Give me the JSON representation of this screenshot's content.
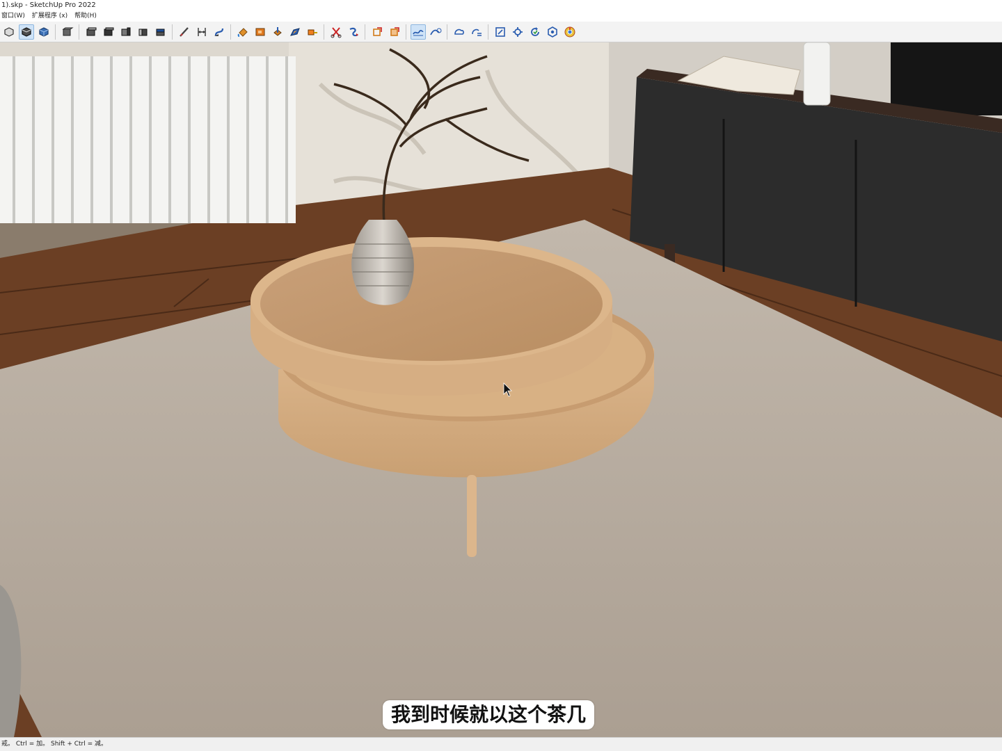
{
  "window": {
    "title": "1).skp - SketchUp Pro 2022"
  },
  "menu": {
    "items": [
      {
        "label": "窗口(W)"
      },
      {
        "label": "扩展程序 (x)"
      },
      {
        "label": "帮助(H)"
      }
    ]
  },
  "toolbar": {
    "icons": [
      "monochrome-style-icon",
      "shaded-style-icon",
      "textured-style-icon",
      "iso-view-icon",
      "top-view-icon",
      "front-view-icon",
      "right-view-icon",
      "back-view-icon",
      "left-view-icon",
      "line-tool-icon",
      "dimension-tool-icon",
      "follow-me-icon",
      "paint-bucket-icon",
      "material-icon",
      "push-pull-icon",
      "offset-icon",
      "tape-measure-icon",
      "scissors-icon",
      "rotate-arrow-icon",
      "section-plane-icon",
      "section-fill-icon",
      "sandbox-from-contours-icon",
      "sandbox-smoove-icon",
      "sandbox-stamp-icon",
      "sandbox-drape-icon",
      "zoom-extents-icon",
      "extension-manager-icon",
      "refresh-icon",
      "component-icon",
      "chrome-icon"
    ]
  },
  "viewport": {
    "subtitle": "我到时候就以这个茶几"
  },
  "statusbar": {
    "hint": "戒。 Ctrl = 加。 Shift + Ctrl = 减。"
  }
}
